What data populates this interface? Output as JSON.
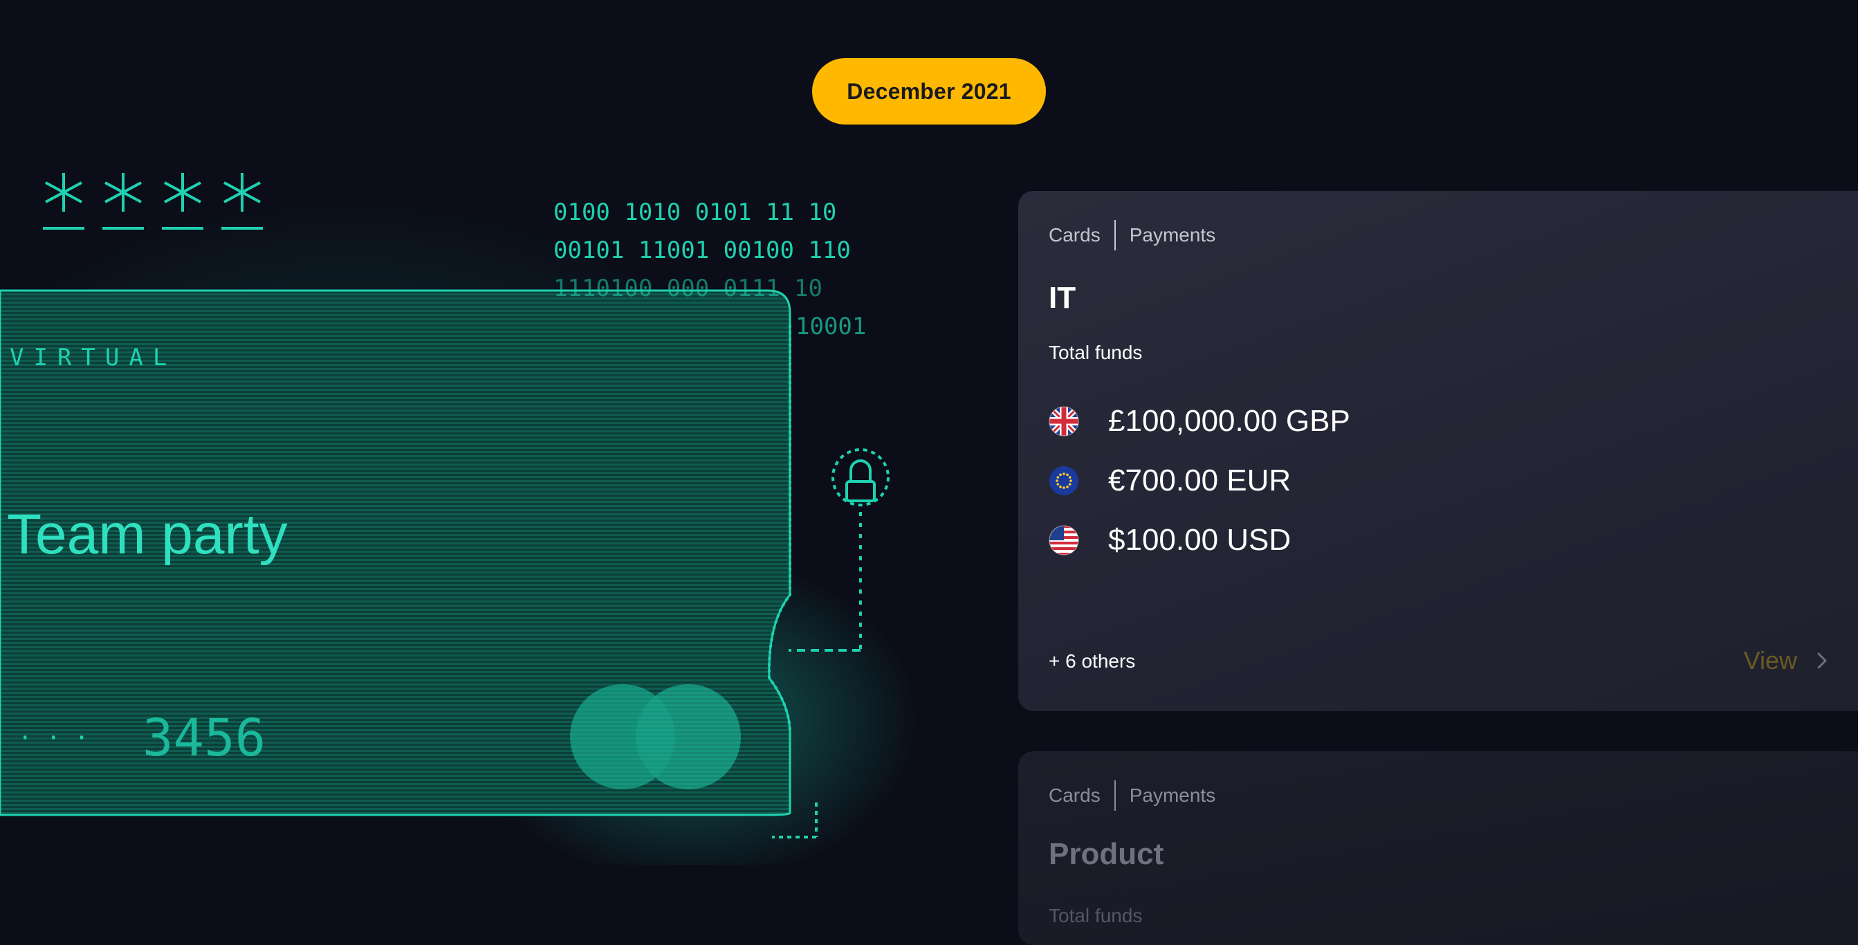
{
  "date_filter": {
    "label": "December 2021"
  },
  "card_art": {
    "card_type": "VIRTUAL",
    "card_name": "Team party",
    "masked_digits": "· · ·",
    "last_digits": "3456",
    "code_lines": [
      "0100 1010 0101   11 10",
      "00101 11001 00100 110",
      "1110100 000 0111 10",
      "10001"
    ],
    "accent": "#19c8a8"
  },
  "accounts": [
    {
      "breadcrumb": [
        "Cards",
        "Payments"
      ],
      "team": "IT",
      "total_label": "Total funds",
      "balances": [
        {
          "flag": "uk-flag-icon",
          "amount": "£100,000.00 GBP"
        },
        {
          "flag": "eu-flag-icon",
          "amount": "€700.00 EUR"
        },
        {
          "flag": "us-flag-icon",
          "amount": "$100.00 USD"
        }
      ],
      "others": "+ 6 others",
      "view_label": "View"
    },
    {
      "breadcrumb": [
        "Cards",
        "Payments"
      ],
      "team": "Product",
      "total_label": "Total funds"
    }
  ]
}
